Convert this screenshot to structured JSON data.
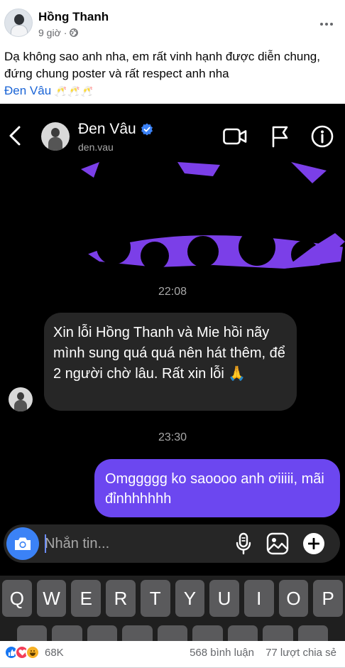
{
  "post": {
    "author": "Hồng Thanh",
    "time": "9 giờ",
    "privacy_separator": "·",
    "text": "Dạ không sao anh nha, em rất vinh hạnh được diễn chung, đứng chung poster và rất respect anh nha",
    "mention": "Đen Vâu",
    "emoji": "🥂🥂🥂",
    "icons": [
      "avatar",
      "globe-icon",
      "more-icon"
    ]
  },
  "dm": {
    "contact_name": "Đen Vâu",
    "contact_handle": "den.vau",
    "icons": [
      "back-icon",
      "verified-icon",
      "video-call-icon",
      "flag-icon",
      "info-icon"
    ],
    "messages": [
      {
        "type": "timestamp",
        "text": "22:08"
      },
      {
        "type": "received",
        "text": "Xin lỗi Hồng Thanh và Mie hồi nãy mình sung quá quá nên hát thêm, để 2 người chờ lâu. Rất xin lỗi 🙏"
      },
      {
        "type": "timestamp",
        "text": "23:30"
      },
      {
        "type": "sent",
        "text": "Omggggg ko saoooo anh ơiiiii, mãi đỉnhhhhhh"
      }
    ],
    "composer": {
      "placeholder": "Nhắn tin...",
      "icons": [
        "camera-icon",
        "mic-icon",
        "gallery-icon",
        "plus-icon"
      ]
    },
    "colors": {
      "sent_bubble": "#6c47f0",
      "received_bubble": "#262626",
      "camera_button": "#3b82f6",
      "background": "#000000"
    }
  },
  "keyboard": {
    "row1": [
      "Q",
      "W",
      "E",
      "R",
      "T",
      "Y",
      "U",
      "I",
      "O",
      "P"
    ],
    "row2": [
      "",
      "",
      "",
      "",
      "",
      "",
      "",
      "",
      ""
    ]
  },
  "footer": {
    "reactions": [
      "like",
      "love",
      "haha"
    ],
    "reaction_count": "68K",
    "comments": "568 bình luận",
    "shares": "77 lượt chia sẻ"
  }
}
